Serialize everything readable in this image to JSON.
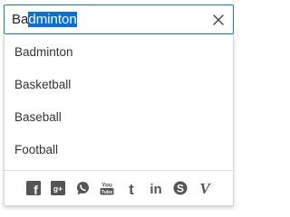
{
  "combobox": {
    "typed_text": "Ba",
    "autocomplete_selected_text": "dminton",
    "clear_icon": "close-icon",
    "accent_color": "#1e78c8",
    "selection_color": "#0a6fd6"
  },
  "dropdown": {
    "items": [
      {
        "label": "Badminton"
      },
      {
        "label": "Basketball"
      },
      {
        "label": "Baseball"
      },
      {
        "label": "Football"
      }
    ],
    "footer_icons": [
      {
        "name": "facebook-icon",
        "glyph": "f"
      },
      {
        "name": "google-plus-icon",
        "glyph": "g+"
      },
      {
        "name": "whatsapp-icon"
      },
      {
        "name": "youtube-icon",
        "glyph_top": "You",
        "glyph_bottom": "Tube"
      },
      {
        "name": "tumblr-icon",
        "glyph": "t"
      },
      {
        "name": "linkedin-icon",
        "glyph": "in"
      },
      {
        "name": "skype-icon",
        "glyph": "S"
      },
      {
        "name": "vimeo-icon",
        "glyph": "V"
      }
    ],
    "icon_color": "#555555"
  }
}
